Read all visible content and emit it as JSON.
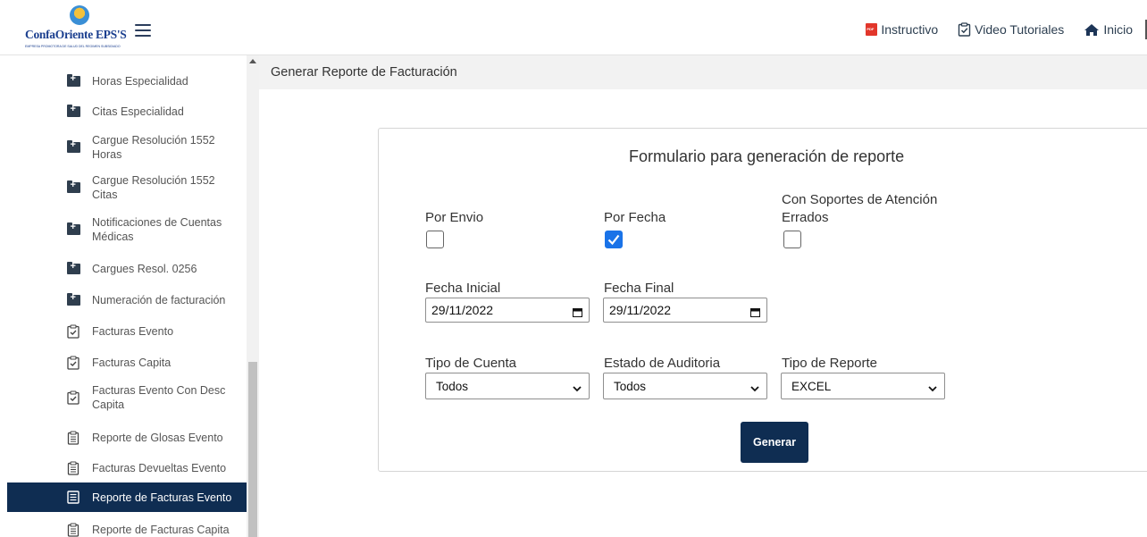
{
  "header": {
    "logo_text": "ConfaOriente EPS'S",
    "logo_sub": "EMPRESA PROMOTORA DE SALUD DEL REGIMEN SUBSIDIADO",
    "links": [
      {
        "label": "Instructivo",
        "icon": "pdf-icon"
      },
      {
        "label": "Video Tutoriales",
        "icon": "clipboard-check-icon"
      },
      {
        "label": "Inicio",
        "icon": "home-icon"
      }
    ]
  },
  "sidebar": {
    "items": [
      {
        "label": "Horas Especialidad",
        "icon": "folder-plus-icon"
      },
      {
        "label": "Citas Especialidad",
        "icon": "folder-plus-icon"
      },
      {
        "label": "Cargue Resolución 1552 Horas",
        "icon": "folder-plus-icon"
      },
      {
        "label": "Cargue Resolución 1552 Citas",
        "icon": "folder-plus-icon"
      },
      {
        "label": "Notificaciones de Cuentas Médicas",
        "icon": "folder-plus-icon"
      },
      {
        "label": "Cargues Resol. 0256",
        "icon": "folder-plus-icon"
      },
      {
        "label": "Numeración de facturación",
        "icon": "folder-plus-icon"
      },
      {
        "label": "Facturas Evento",
        "icon": "clipboard-check-icon"
      },
      {
        "label": "Facturas Capita",
        "icon": "clipboard-check-icon"
      },
      {
        "label": "Facturas Evento Con Desc Capita",
        "icon": "clipboard-check-icon"
      },
      {
        "label": "Reporte de Glosas Evento",
        "icon": "clipboard-icon"
      },
      {
        "label": "Facturas Devueltas Evento",
        "icon": "clipboard-icon"
      },
      {
        "label": "Reporte de Facturas Evento",
        "icon": "list-icon",
        "active": true
      },
      {
        "label": "Reporte de Facturas Capita",
        "icon": "clipboard-icon"
      }
    ]
  },
  "main": {
    "title": "Generar Reporte de Facturación",
    "form": {
      "title": "Formulario para generación de reporte",
      "checkboxes": [
        {
          "label": "Por Envio",
          "checked": false
        },
        {
          "label": "Por Fecha",
          "checked": true
        },
        {
          "label": "Con Soportes de Atención Errados",
          "checked": false
        }
      ],
      "fecha_inicial_label": "Fecha Inicial",
      "fecha_inicial_value": "29/11/2022",
      "fecha_final_label": "Fecha Final",
      "fecha_final_value": "29/11/2022",
      "tipo_cuenta_label": "Tipo de Cuenta",
      "tipo_cuenta_value": "Todos",
      "estado_auditoria_label": "Estado de Auditoria",
      "estado_auditoria_value": "Todos",
      "tipo_reporte_label": "Tipo de Reporte",
      "tipo_reporte_value": "EXCEL",
      "submit_label": "Generar"
    }
  },
  "colors": {
    "accent_dark": "#0f2d52",
    "checkbox_checked": "#1a73e8",
    "brand_blue": "#1b3f8f"
  }
}
